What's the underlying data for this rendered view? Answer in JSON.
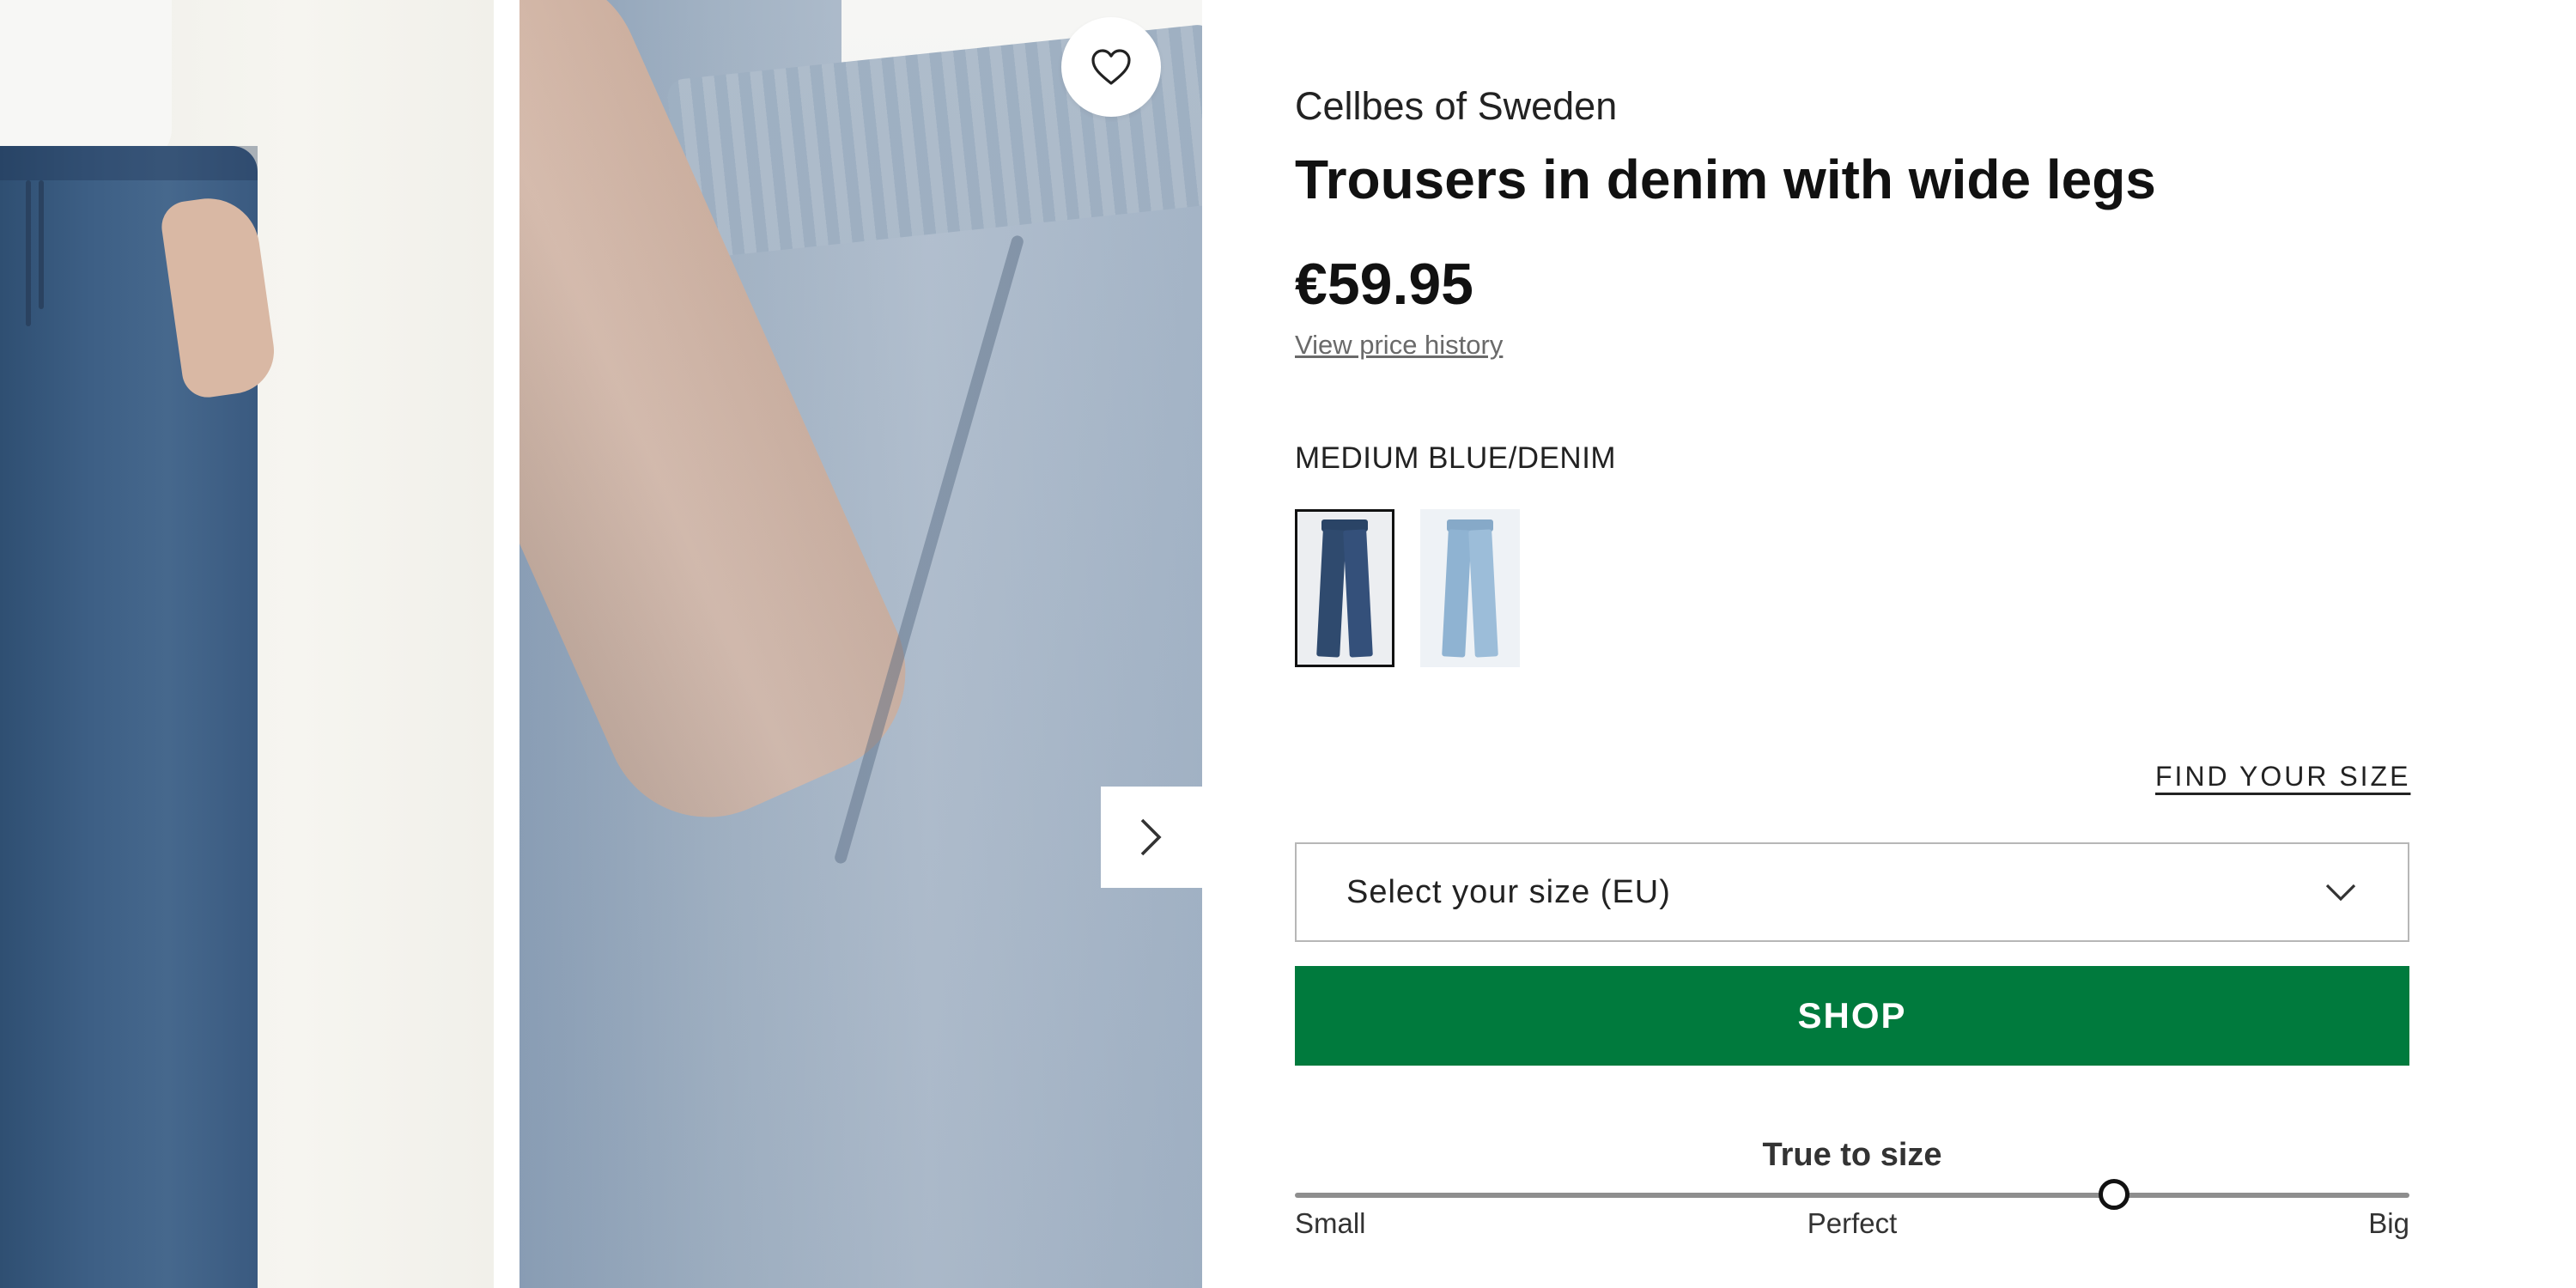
{
  "gallery": {
    "icons": {
      "wishlist": "heart-icon",
      "next": "chevron-right-icon"
    }
  },
  "product": {
    "brand": "Cellbes of Sweden",
    "title": "Trousers in denim with wide legs",
    "price": "€59.95",
    "price_history_link": "View price history",
    "color_name": "MEDIUM BLUE/DENIM",
    "variants": [
      {
        "name": "Medium blue/denim",
        "color": "#2f4a6e",
        "selected": true
      },
      {
        "name": "Light blue/denim",
        "color": "#8fb3d2",
        "selected": false
      }
    ]
  },
  "size": {
    "find_size_link": "FIND YOUR SIZE",
    "select_placeholder": "Select your size (EU)",
    "chevron_icon": "chevron-down-icon"
  },
  "actions": {
    "shop_label": "SHOP",
    "shop_color": "#007a3d"
  },
  "fit": {
    "title": "True to size",
    "labels": [
      "Small",
      "Perfect",
      "Big"
    ],
    "value": 0.735
  }
}
